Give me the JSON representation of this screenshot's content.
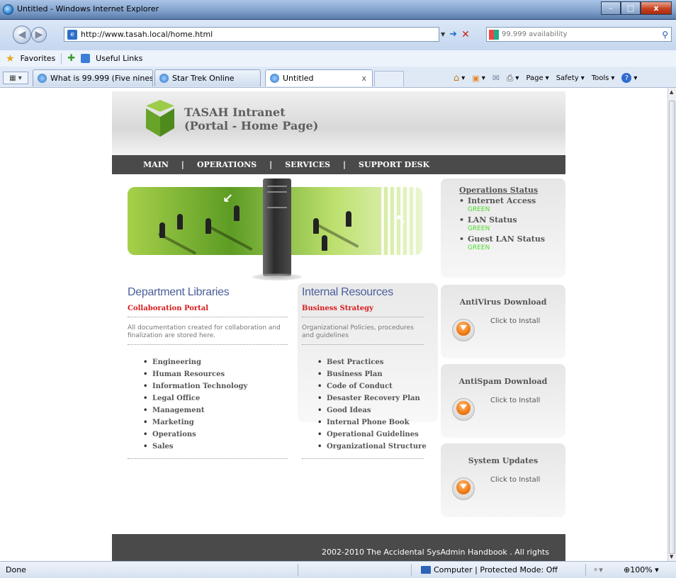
{
  "window": {
    "title": "Untitled - Windows Internet Explorer",
    "minimize": "–",
    "maximize": "□",
    "close": "x"
  },
  "address_bar": {
    "url": "http://www.tasah.local/home.html",
    "search_value": "99.999 availability"
  },
  "favorites_bar": {
    "favorites_label": "Favorites",
    "useful_links_label": "Useful Links"
  },
  "tabs": [
    {
      "label": "What is 99.999 (Five nines ..."
    },
    {
      "label": "Star Trek Online"
    },
    {
      "label": "Untitled",
      "close": "x"
    }
  ],
  "command_bar": {
    "page_label": "Page",
    "safety_label": "Safety",
    "tools_label": "Tools"
  },
  "site": {
    "title_line1": "TASAH Intranet",
    "title_line2": "(Portal - Home Page)",
    "nav": [
      "MAIN",
      "OPERATIONS",
      "SERVICES",
      "SUPPORT DESK"
    ],
    "nav_separator": "|"
  },
  "operations_status": {
    "title": "Operations Status",
    "items": [
      {
        "label": "Internet Access",
        "status": "GREEN"
      },
      {
        "label": "LAN Status",
        "status": "GREEN"
      },
      {
        "label": "Guest LAN Status",
        "status": "GREEN"
      }
    ],
    "status_color": "#4edb2c"
  },
  "downloads": [
    {
      "title": "AntiVirus Download",
      "link": "Click to Install"
    },
    {
      "title": "AntiSpam Download",
      "link": "Click to Install"
    },
    {
      "title": "System Updates",
      "link": "Click to Install"
    }
  ],
  "department_libraries": {
    "heading": "Department Libraries",
    "subheading": "Collaboration Portal",
    "description": "All documentation created for collaboration and finalization are stored here.",
    "items": [
      "Engineering",
      "Human Resources",
      "Information Technology",
      "Legal Office",
      "Management",
      "Marketing",
      "Operations",
      "Sales"
    ]
  },
  "internal_resources": {
    "heading": "Internal Resources",
    "subheading": "Business Strategy",
    "description": "Organizational Policies, procedures and guidelines",
    "items": [
      "Best Practices",
      "Business Plan",
      "Code of Conduct",
      "Desaster Recovery Plan",
      "Good Ideas",
      "Internal Phone Book",
      "Operational Guidelines",
      "Organizational Structure"
    ]
  },
  "footer": {
    "text": "2002-2010 The Accidental SysAdmin Handbook . All rights"
  },
  "status_bar": {
    "left_text": "Done",
    "zone_text": "Computer | Protected Mode: Off",
    "zoom": "100%"
  },
  "colors": {
    "nav_bg": "#4a4a4a",
    "heading_blue": "#4a5f9c",
    "subheading_red": "#d81a1a"
  }
}
